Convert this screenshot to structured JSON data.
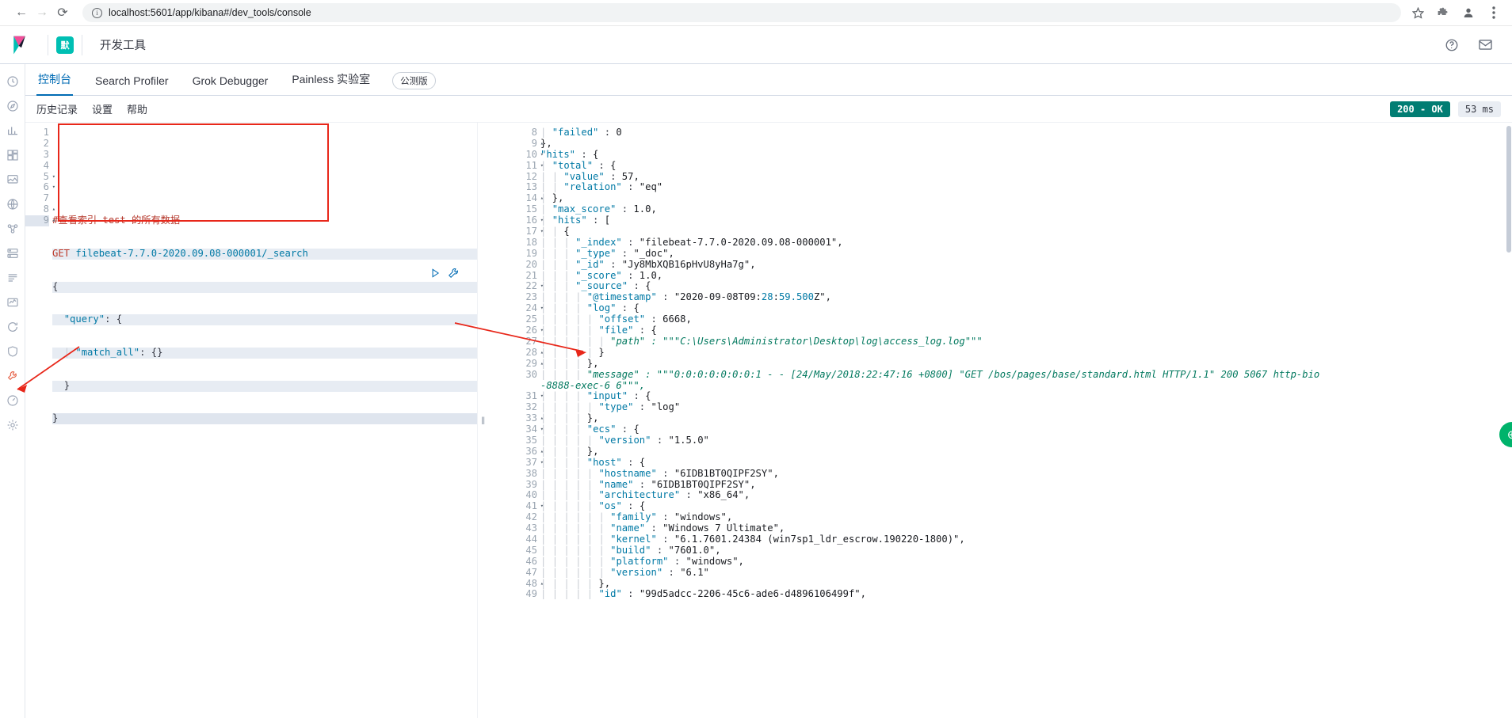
{
  "browser": {
    "back_label": "←",
    "forward_label": "→",
    "reload_label": "⟳",
    "url": "localhost:5601/app/kibana#/dev_tools/console",
    "info_label": "i",
    "star_icon": "bookmark-star-icon",
    "extension_icon": "puzzle-icon",
    "profile_icon": "user-avatar-icon",
    "menu_icon": "kebab-menu-icon"
  },
  "kibana_header": {
    "logo_name": "kibana-logo",
    "space_badge": "默",
    "title": "开发工具",
    "help_icon": "help-circle-icon",
    "mail_icon": "mail-icon"
  },
  "rail": {
    "items": [
      {
        "name": "recently-viewed",
        "glyph": "◴"
      },
      {
        "name": "discover",
        "glyph": "◎"
      },
      {
        "name": "visualize",
        "glyph": "ᴵ"
      },
      {
        "name": "dashboard",
        "glyph": "▦"
      },
      {
        "name": "canvas",
        "glyph": "▣"
      },
      {
        "name": "maps",
        "glyph": "◉"
      },
      {
        "name": "machine-learning",
        "glyph": "✻"
      },
      {
        "name": "infrastructure",
        "glyph": "☸"
      },
      {
        "name": "logs",
        "glyph": "☰"
      },
      {
        "name": "apm",
        "glyph": "⎙"
      },
      {
        "name": "uptime",
        "glyph": "↻"
      },
      {
        "name": "siem",
        "glyph": "◔"
      },
      {
        "name": "dev-tools",
        "glyph": "⚒"
      },
      {
        "name": "monitoring",
        "glyph": "❁"
      },
      {
        "name": "management",
        "glyph": "⚙"
      }
    ]
  },
  "tabs": [
    {
      "label": "控制台",
      "name": "tab-console",
      "active": true
    },
    {
      "label": "Search Profiler",
      "name": "tab-search-profiler",
      "active": false
    },
    {
      "label": "Grok Debugger",
      "name": "tab-grok-debugger",
      "active": false
    },
    {
      "label": "Painless 实验室",
      "name": "tab-painless-lab",
      "active": false
    }
  ],
  "beta_badge": "公测版",
  "console_toolbar": {
    "history": "历史记录",
    "settings": "设置",
    "help": "帮助",
    "status_code": "200 - OK",
    "elapsed": "53 ms"
  },
  "editor": {
    "play_icon": "play-triangle-icon",
    "wrench_icon": "wrench-icon",
    "line_numbers": [
      "1",
      "2",
      "3",
      "4",
      "5",
      "6",
      "7",
      "8",
      "9"
    ],
    "folds": [
      "",
      "",
      "",
      "",
      "▾",
      "▾",
      "",
      "▴",
      "▴"
    ],
    "lines": [
      {
        "n": 1,
        "text": ""
      },
      {
        "n": 2,
        "text": ""
      },
      {
        "n": 3,
        "text": "#查看索引 test 的所有数据",
        "kind": "comment"
      },
      {
        "n": 4,
        "text": "GET filebeat-7.7.0-2020.09.08-000001/_search",
        "kind": "request"
      },
      {
        "n": 5,
        "text": "{",
        "kind": "punc"
      },
      {
        "n": 6,
        "text": "  \"query\": {",
        "kind": "json"
      },
      {
        "n": 7,
        "text": "    \"match_all\": {}",
        "kind": "json"
      },
      {
        "n": 8,
        "text": "  }",
        "kind": "punc"
      },
      {
        "n": 9,
        "text": "}",
        "kind": "punc"
      }
    ],
    "method": "GET",
    "path": "filebeat-7.7.0-2020.09.08-000001/_search"
  },
  "response": {
    "lines": [
      {
        "n": 8,
        "fold": "",
        "indent": 1,
        "text": "\"failed\" : 0"
      },
      {
        "n": 9,
        "fold": "▴",
        "indent": 0,
        "text": "},"
      },
      {
        "n": 10,
        "fold": "▾",
        "indent": 0,
        "text": "\"hits\" : {"
      },
      {
        "n": 11,
        "fold": "▾",
        "indent": 1,
        "text": "\"total\" : {"
      },
      {
        "n": 12,
        "fold": "",
        "indent": 2,
        "text": "\"value\" : 57,"
      },
      {
        "n": 13,
        "fold": "",
        "indent": 2,
        "text": "\"relation\" : \"eq\""
      },
      {
        "n": 14,
        "fold": "▴",
        "indent": 1,
        "text": "},"
      },
      {
        "n": 15,
        "fold": "",
        "indent": 1,
        "text": "\"max_score\" : 1.0,"
      },
      {
        "n": 16,
        "fold": "▾",
        "indent": 1,
        "text": "\"hits\" : ["
      },
      {
        "n": 17,
        "fold": "▾",
        "indent": 2,
        "text": "{"
      },
      {
        "n": 18,
        "fold": "",
        "indent": 3,
        "text": "\"_index\" : \"filebeat-7.7.0-2020.09.08-000001\","
      },
      {
        "n": 19,
        "fold": "",
        "indent": 3,
        "text": "\"_type\" : \"_doc\","
      },
      {
        "n": 20,
        "fold": "",
        "indent": 3,
        "text": "\"_id\" : \"Jy8MbXQB16pHvU8yHa7g\","
      },
      {
        "n": 21,
        "fold": "",
        "indent": 3,
        "text": "\"_score\" : 1.0,"
      },
      {
        "n": 22,
        "fold": "▾",
        "indent": 3,
        "text": "\"_source\" : {"
      },
      {
        "n": 23,
        "fold": "",
        "indent": 4,
        "text": "\"@timestamp\" : \"2020-09-08T09:28:59.500Z\","
      },
      {
        "n": 24,
        "fold": "▾",
        "indent": 4,
        "text": "\"log\" : {"
      },
      {
        "n": 25,
        "fold": "",
        "indent": 5,
        "text": "\"offset\" : 6668,"
      },
      {
        "n": 26,
        "fold": "▾",
        "indent": 5,
        "text": "\"file\" : {"
      },
      {
        "n": 27,
        "fold": "",
        "indent": 6,
        "text": "\"path\" : \"\"\"C:\\Users\\Administrator\\Desktop\\log\\access_log.log\"\"\"",
        "italic": true
      },
      {
        "n": 28,
        "fold": "▴",
        "indent": 5,
        "text": "}"
      },
      {
        "n": 29,
        "fold": "▴",
        "indent": 4,
        "text": "},"
      },
      {
        "n": 30,
        "fold": "",
        "indent": 4,
        "text": "\"message\" : \"\"\"0:0:0:0:0:0:0:1 - - [24/May/2018:22:47:16 +0800] \"GET /bos/pages/base/standard.html HTTP/1.1\" 200 5067 http-bio",
        "italic": true,
        "wrap": "-8888-exec-6 6\"\"\","
      },
      {
        "n": 31,
        "fold": "▾",
        "indent": 4,
        "text": "\"input\" : {"
      },
      {
        "n": 32,
        "fold": "",
        "indent": 5,
        "text": "\"type\" : \"log\""
      },
      {
        "n": 33,
        "fold": "▴",
        "indent": 4,
        "text": "},"
      },
      {
        "n": 34,
        "fold": "▾",
        "indent": 4,
        "text": "\"ecs\" : {"
      },
      {
        "n": 35,
        "fold": "",
        "indent": 5,
        "text": "\"version\" : \"1.5.0\""
      },
      {
        "n": 36,
        "fold": "▴",
        "indent": 4,
        "text": "},"
      },
      {
        "n": 37,
        "fold": "▾",
        "indent": 4,
        "text": "\"host\" : {"
      },
      {
        "n": 38,
        "fold": "",
        "indent": 5,
        "text": "\"hostname\" : \"6IDB1BT0QIPF2SY\","
      },
      {
        "n": 39,
        "fold": "",
        "indent": 5,
        "text": "\"name\" : \"6IDB1BT0QIPF2SY\","
      },
      {
        "n": 40,
        "fold": "",
        "indent": 5,
        "text": "\"architecture\" : \"x86_64\","
      },
      {
        "n": 41,
        "fold": "▾",
        "indent": 5,
        "text": "\"os\" : {"
      },
      {
        "n": 42,
        "fold": "",
        "indent": 6,
        "text": "\"family\" : \"windows\","
      },
      {
        "n": 43,
        "fold": "",
        "indent": 6,
        "text": "\"name\" : \"Windows 7 Ultimate\","
      },
      {
        "n": 44,
        "fold": "",
        "indent": 6,
        "text": "\"kernel\" : \"6.1.7601.24384 (win7sp1_ldr_escrow.190220-1800)\","
      },
      {
        "n": 45,
        "fold": "",
        "indent": 6,
        "text": "\"build\" : \"7601.0\","
      },
      {
        "n": 46,
        "fold": "",
        "indent": 6,
        "text": "\"platform\" : \"windows\","
      },
      {
        "n": 47,
        "fold": "",
        "indent": 6,
        "text": "\"version\" : \"6.1\""
      },
      {
        "n": 48,
        "fold": "▴",
        "indent": 5,
        "text": "},"
      },
      {
        "n": 49,
        "fold": "",
        "indent": 5,
        "text": "\"id\" : \"99d5adcc-2206-45c6-ade6-d4896106499f\","
      }
    ]
  },
  "annotations": {
    "rect_name": "red-highlight-rectangle",
    "arrow_left_name": "red-arrow-to-dev-tools",
    "arrow_right_name": "red-arrow-to-response-line-29",
    "color": "#e8271a"
  },
  "splitter_glyph": "‖",
  "float_button_glyph": "⊕"
}
